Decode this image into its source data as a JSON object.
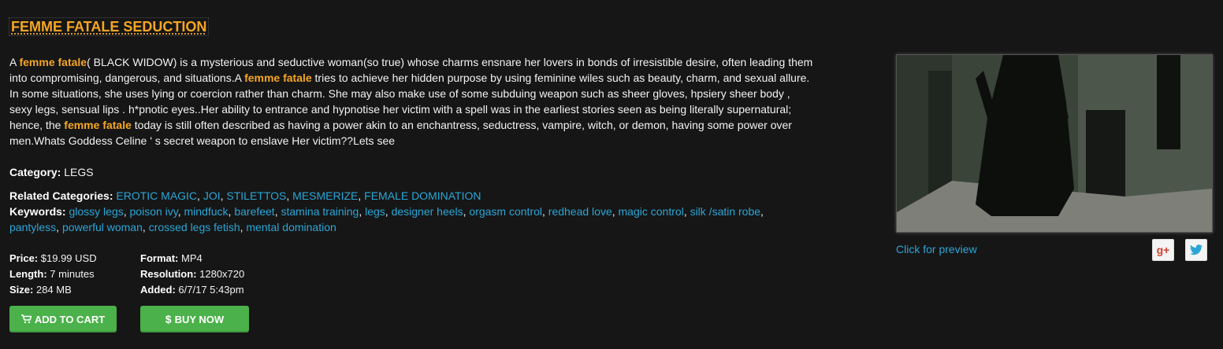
{
  "title": "FEMME FATALE SEDUCTION",
  "description": {
    "p1": "A ",
    "hl1": "femme fatale",
    "p2": "( BLACK WIDOW) is a mysterious and seductive woman(so true) whose charms ensnare her lovers in bonds of irresistible desire, often leading them into compromising, dangerous, and situations.A ",
    "hl2": "femme fatale",
    "p3": " tries to achieve her hidden purpose by using feminine wiles such as beauty, charm, and sexual allure. In some situations, she uses lying or coercion rather than charm. She may also make use of some subduing weapon such as sheer gloves, hpsiery sheer body , sexy legs, sensual lips . h*pnotic eyes..Her ability to entrance and hypnotise her victim with a spell was in the earliest stories seen as being literally supernatural; hence, the ",
    "hl3": "femme fatale",
    "p4": " today is still often described as having a power akin to an enchantress, seductress, vampire, witch, or demon, having some power over men.Whats Goddess Celine ' s secret weapon to enslave Her victim??Lets see"
  },
  "category": {
    "label": "Category:",
    "value": "LEGS"
  },
  "related": {
    "label": "Related Categories:",
    "items": [
      "EROTIC MAGIC",
      "JOI",
      "STILETTOS",
      "MESMERIZE",
      "FEMALE DOMINATION"
    ]
  },
  "keywords": {
    "label": "Keywords:",
    "items": [
      "glossy legs",
      "poison ivy",
      "mindfuck",
      "barefeet",
      "stamina training",
      "legs",
      "designer heels",
      "orgasm control",
      "redhead love",
      "magic control",
      "silk /satin robe",
      "pantyless",
      "powerful woman",
      "crossed legs fetish",
      "mental domination"
    ]
  },
  "meta": {
    "price_label": "Price:",
    "price": "$19.99 USD",
    "length_label": "Length:",
    "length": "7 minutes",
    "size_label": "Size:",
    "size": "284 MB",
    "format_label": "Format:",
    "format": "MP4",
    "resolution_label": "Resolution:",
    "resolution": "1280x720",
    "added_label": "Added:",
    "added": "6/7/17 5:43pm"
  },
  "buttons": {
    "add_to_cart": "ADD TO CART",
    "buy_now": "BUY NOW",
    "cart_icon": "shopping-cart-icon",
    "dollar_icon": "dollar-icon"
  },
  "preview": {
    "link_text": "Click for preview"
  },
  "share": {
    "gplus": "g+",
    "twitter": "twitter-bird-icon"
  },
  "colors": {
    "accent": "#f5a623",
    "link": "#2aa6d6",
    "button": "#4bb14a",
    "background": "#161616"
  }
}
